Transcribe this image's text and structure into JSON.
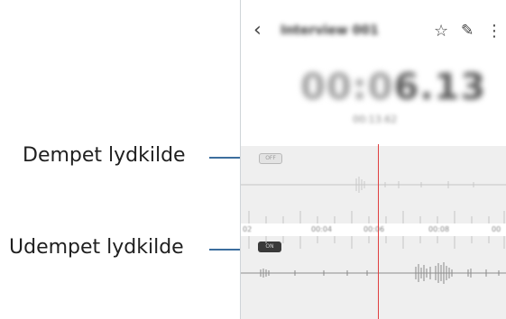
{
  "callouts": {
    "muted_source": "Dempet lydkilde",
    "unmuted_source": "Udempet lydkilde"
  },
  "header": {
    "back_icon": "chevron-left-icon",
    "title": "Interview 001",
    "favorite_icon": "star-outline-icon",
    "edit_icon": "pencil-icon",
    "more_icon": "more-vertical-icon"
  },
  "timer": {
    "dim": "00:0",
    "bright": "6.13",
    "sub": "00:13.62"
  },
  "tracks": {
    "muted_badge": "OFF",
    "unmuted_badge": "ON"
  },
  "ruler": {
    "labels": [
      "02",
      "00:04",
      "00:06",
      "00:08",
      "00"
    ]
  },
  "colors": {
    "callout_line": "#3c6e9e",
    "playhead": "#e04040",
    "track_background": "#efefef"
  }
}
